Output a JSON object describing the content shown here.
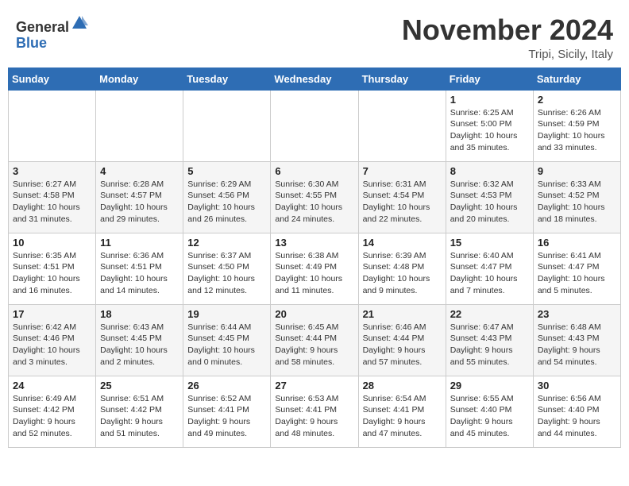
{
  "header": {
    "logo_general": "General",
    "logo_blue": "Blue",
    "month_title": "November 2024",
    "subtitle": "Tripi, Sicily, Italy"
  },
  "weekdays": [
    "Sunday",
    "Monday",
    "Tuesday",
    "Wednesday",
    "Thursday",
    "Friday",
    "Saturday"
  ],
  "weeks": [
    [
      {
        "day": "",
        "info": ""
      },
      {
        "day": "",
        "info": ""
      },
      {
        "day": "",
        "info": ""
      },
      {
        "day": "",
        "info": ""
      },
      {
        "day": "",
        "info": ""
      },
      {
        "day": "1",
        "info": "Sunrise: 6:25 AM\nSunset: 5:00 PM\nDaylight: 10 hours and 35 minutes."
      },
      {
        "day": "2",
        "info": "Sunrise: 6:26 AM\nSunset: 4:59 PM\nDaylight: 10 hours and 33 minutes."
      }
    ],
    [
      {
        "day": "3",
        "info": "Sunrise: 6:27 AM\nSunset: 4:58 PM\nDaylight: 10 hours and 31 minutes."
      },
      {
        "day": "4",
        "info": "Sunrise: 6:28 AM\nSunset: 4:57 PM\nDaylight: 10 hours and 29 minutes."
      },
      {
        "day": "5",
        "info": "Sunrise: 6:29 AM\nSunset: 4:56 PM\nDaylight: 10 hours and 26 minutes."
      },
      {
        "day": "6",
        "info": "Sunrise: 6:30 AM\nSunset: 4:55 PM\nDaylight: 10 hours and 24 minutes."
      },
      {
        "day": "7",
        "info": "Sunrise: 6:31 AM\nSunset: 4:54 PM\nDaylight: 10 hours and 22 minutes."
      },
      {
        "day": "8",
        "info": "Sunrise: 6:32 AM\nSunset: 4:53 PM\nDaylight: 10 hours and 20 minutes."
      },
      {
        "day": "9",
        "info": "Sunrise: 6:33 AM\nSunset: 4:52 PM\nDaylight: 10 hours and 18 minutes."
      }
    ],
    [
      {
        "day": "10",
        "info": "Sunrise: 6:35 AM\nSunset: 4:51 PM\nDaylight: 10 hours and 16 minutes."
      },
      {
        "day": "11",
        "info": "Sunrise: 6:36 AM\nSunset: 4:51 PM\nDaylight: 10 hours and 14 minutes."
      },
      {
        "day": "12",
        "info": "Sunrise: 6:37 AM\nSunset: 4:50 PM\nDaylight: 10 hours and 12 minutes."
      },
      {
        "day": "13",
        "info": "Sunrise: 6:38 AM\nSunset: 4:49 PM\nDaylight: 10 hours and 11 minutes."
      },
      {
        "day": "14",
        "info": "Sunrise: 6:39 AM\nSunset: 4:48 PM\nDaylight: 10 hours and 9 minutes."
      },
      {
        "day": "15",
        "info": "Sunrise: 6:40 AM\nSunset: 4:47 PM\nDaylight: 10 hours and 7 minutes."
      },
      {
        "day": "16",
        "info": "Sunrise: 6:41 AM\nSunset: 4:47 PM\nDaylight: 10 hours and 5 minutes."
      }
    ],
    [
      {
        "day": "17",
        "info": "Sunrise: 6:42 AM\nSunset: 4:46 PM\nDaylight: 10 hours and 3 minutes."
      },
      {
        "day": "18",
        "info": "Sunrise: 6:43 AM\nSunset: 4:45 PM\nDaylight: 10 hours and 2 minutes."
      },
      {
        "day": "19",
        "info": "Sunrise: 6:44 AM\nSunset: 4:45 PM\nDaylight: 10 hours and 0 minutes."
      },
      {
        "day": "20",
        "info": "Sunrise: 6:45 AM\nSunset: 4:44 PM\nDaylight: 9 hours and 58 minutes."
      },
      {
        "day": "21",
        "info": "Sunrise: 6:46 AM\nSunset: 4:44 PM\nDaylight: 9 hours and 57 minutes."
      },
      {
        "day": "22",
        "info": "Sunrise: 6:47 AM\nSunset: 4:43 PM\nDaylight: 9 hours and 55 minutes."
      },
      {
        "day": "23",
        "info": "Sunrise: 6:48 AM\nSunset: 4:43 PM\nDaylight: 9 hours and 54 minutes."
      }
    ],
    [
      {
        "day": "24",
        "info": "Sunrise: 6:49 AM\nSunset: 4:42 PM\nDaylight: 9 hours and 52 minutes."
      },
      {
        "day": "25",
        "info": "Sunrise: 6:51 AM\nSunset: 4:42 PM\nDaylight: 9 hours and 51 minutes."
      },
      {
        "day": "26",
        "info": "Sunrise: 6:52 AM\nSunset: 4:41 PM\nDaylight: 9 hours and 49 minutes."
      },
      {
        "day": "27",
        "info": "Sunrise: 6:53 AM\nSunset: 4:41 PM\nDaylight: 9 hours and 48 minutes."
      },
      {
        "day": "28",
        "info": "Sunrise: 6:54 AM\nSunset: 4:41 PM\nDaylight: 9 hours and 47 minutes."
      },
      {
        "day": "29",
        "info": "Sunrise: 6:55 AM\nSunset: 4:40 PM\nDaylight: 9 hours and 45 minutes."
      },
      {
        "day": "30",
        "info": "Sunrise: 6:56 AM\nSunset: 4:40 PM\nDaylight: 9 hours and 44 minutes."
      }
    ]
  ]
}
